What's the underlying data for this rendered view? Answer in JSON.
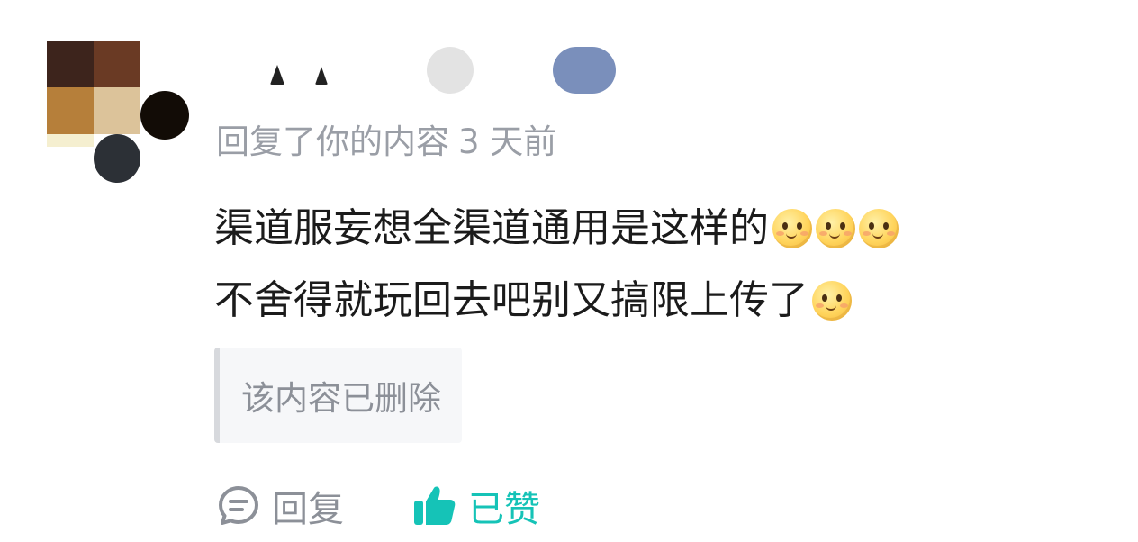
{
  "comment": {
    "meta": {
      "action_text": "回复了你的内容",
      "time_text": "3 天前"
    },
    "body_lines": [
      "渠道服妄想全渠道通用是这样的",
      "不舍得就玩回去吧别又搞限上传了"
    ],
    "emojis": {
      "line1": [
        "smile-emoji",
        "smile-emoji",
        "smile-emoji"
      ],
      "line2": [
        "smile-emoji"
      ]
    },
    "quoted": {
      "text": "该内容已删除"
    },
    "actions": {
      "reply_label": "回复",
      "like_label": "已赞",
      "reply_icon": "comment-bubble-icon",
      "like_icon": "thumbs-up-icon"
    }
  },
  "colors": {
    "accent": "#15c3b7",
    "muted_text": "#9a9ea6",
    "body_text": "#1b1b1b",
    "quote_bg": "#f6f7f9",
    "quote_border": "#d7d9dd"
  }
}
